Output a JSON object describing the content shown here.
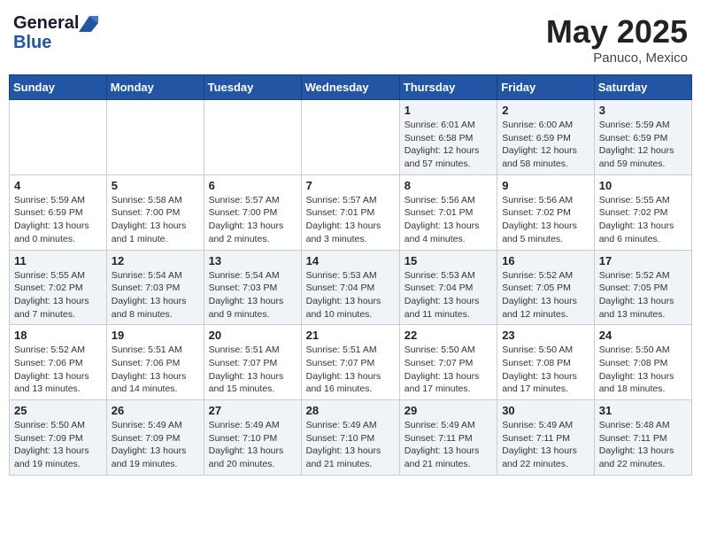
{
  "header": {
    "logo_line1": "General",
    "logo_line2": "Blue",
    "month": "May 2025",
    "location": "Panuco, Mexico"
  },
  "weekdays": [
    "Sunday",
    "Monday",
    "Tuesday",
    "Wednesday",
    "Thursday",
    "Friday",
    "Saturday"
  ],
  "weeks": [
    [
      {
        "day": "",
        "sunrise": "",
        "sunset": "",
        "daylight": ""
      },
      {
        "day": "",
        "sunrise": "",
        "sunset": "",
        "daylight": ""
      },
      {
        "day": "",
        "sunrise": "",
        "sunset": "",
        "daylight": ""
      },
      {
        "day": "",
        "sunrise": "",
        "sunset": "",
        "daylight": ""
      },
      {
        "day": "1",
        "sunrise": "Sunrise: 6:01 AM",
        "sunset": "Sunset: 6:58 PM",
        "daylight": "Daylight: 12 hours and 57 minutes."
      },
      {
        "day": "2",
        "sunrise": "Sunrise: 6:00 AM",
        "sunset": "Sunset: 6:59 PM",
        "daylight": "Daylight: 12 hours and 58 minutes."
      },
      {
        "day": "3",
        "sunrise": "Sunrise: 5:59 AM",
        "sunset": "Sunset: 6:59 PM",
        "daylight": "Daylight: 12 hours and 59 minutes."
      }
    ],
    [
      {
        "day": "4",
        "sunrise": "Sunrise: 5:59 AM",
        "sunset": "Sunset: 6:59 PM",
        "daylight": "Daylight: 13 hours and 0 minutes."
      },
      {
        "day": "5",
        "sunrise": "Sunrise: 5:58 AM",
        "sunset": "Sunset: 7:00 PM",
        "daylight": "Daylight: 13 hours and 1 minute."
      },
      {
        "day": "6",
        "sunrise": "Sunrise: 5:57 AM",
        "sunset": "Sunset: 7:00 PM",
        "daylight": "Daylight: 13 hours and 2 minutes."
      },
      {
        "day": "7",
        "sunrise": "Sunrise: 5:57 AM",
        "sunset": "Sunset: 7:01 PM",
        "daylight": "Daylight: 13 hours and 3 minutes."
      },
      {
        "day": "8",
        "sunrise": "Sunrise: 5:56 AM",
        "sunset": "Sunset: 7:01 PM",
        "daylight": "Daylight: 13 hours and 4 minutes."
      },
      {
        "day": "9",
        "sunrise": "Sunrise: 5:56 AM",
        "sunset": "Sunset: 7:02 PM",
        "daylight": "Daylight: 13 hours and 5 minutes."
      },
      {
        "day": "10",
        "sunrise": "Sunrise: 5:55 AM",
        "sunset": "Sunset: 7:02 PM",
        "daylight": "Daylight: 13 hours and 6 minutes."
      }
    ],
    [
      {
        "day": "11",
        "sunrise": "Sunrise: 5:55 AM",
        "sunset": "Sunset: 7:02 PM",
        "daylight": "Daylight: 13 hours and 7 minutes."
      },
      {
        "day": "12",
        "sunrise": "Sunrise: 5:54 AM",
        "sunset": "Sunset: 7:03 PM",
        "daylight": "Daylight: 13 hours and 8 minutes."
      },
      {
        "day": "13",
        "sunrise": "Sunrise: 5:54 AM",
        "sunset": "Sunset: 7:03 PM",
        "daylight": "Daylight: 13 hours and 9 minutes."
      },
      {
        "day": "14",
        "sunrise": "Sunrise: 5:53 AM",
        "sunset": "Sunset: 7:04 PM",
        "daylight": "Daylight: 13 hours and 10 minutes."
      },
      {
        "day": "15",
        "sunrise": "Sunrise: 5:53 AM",
        "sunset": "Sunset: 7:04 PM",
        "daylight": "Daylight: 13 hours and 11 minutes."
      },
      {
        "day": "16",
        "sunrise": "Sunrise: 5:52 AM",
        "sunset": "Sunset: 7:05 PM",
        "daylight": "Daylight: 13 hours and 12 minutes."
      },
      {
        "day": "17",
        "sunrise": "Sunrise: 5:52 AM",
        "sunset": "Sunset: 7:05 PM",
        "daylight": "Daylight: 13 hours and 13 minutes."
      }
    ],
    [
      {
        "day": "18",
        "sunrise": "Sunrise: 5:52 AM",
        "sunset": "Sunset: 7:06 PM",
        "daylight": "Daylight: 13 hours and 13 minutes."
      },
      {
        "day": "19",
        "sunrise": "Sunrise: 5:51 AM",
        "sunset": "Sunset: 7:06 PM",
        "daylight": "Daylight: 13 hours and 14 minutes."
      },
      {
        "day": "20",
        "sunrise": "Sunrise: 5:51 AM",
        "sunset": "Sunset: 7:07 PM",
        "daylight": "Daylight: 13 hours and 15 minutes."
      },
      {
        "day": "21",
        "sunrise": "Sunrise: 5:51 AM",
        "sunset": "Sunset: 7:07 PM",
        "daylight": "Daylight: 13 hours and 16 minutes."
      },
      {
        "day": "22",
        "sunrise": "Sunrise: 5:50 AM",
        "sunset": "Sunset: 7:07 PM",
        "daylight": "Daylight: 13 hours and 17 minutes."
      },
      {
        "day": "23",
        "sunrise": "Sunrise: 5:50 AM",
        "sunset": "Sunset: 7:08 PM",
        "daylight": "Daylight: 13 hours and 17 minutes."
      },
      {
        "day": "24",
        "sunrise": "Sunrise: 5:50 AM",
        "sunset": "Sunset: 7:08 PM",
        "daylight": "Daylight: 13 hours and 18 minutes."
      }
    ],
    [
      {
        "day": "25",
        "sunrise": "Sunrise: 5:50 AM",
        "sunset": "Sunset: 7:09 PM",
        "daylight": "Daylight: 13 hours and 19 minutes."
      },
      {
        "day": "26",
        "sunrise": "Sunrise: 5:49 AM",
        "sunset": "Sunset: 7:09 PM",
        "daylight": "Daylight: 13 hours and 19 minutes."
      },
      {
        "day": "27",
        "sunrise": "Sunrise: 5:49 AM",
        "sunset": "Sunset: 7:10 PM",
        "daylight": "Daylight: 13 hours and 20 minutes."
      },
      {
        "day": "28",
        "sunrise": "Sunrise: 5:49 AM",
        "sunset": "Sunset: 7:10 PM",
        "daylight": "Daylight: 13 hours and 21 minutes."
      },
      {
        "day": "29",
        "sunrise": "Sunrise: 5:49 AM",
        "sunset": "Sunset: 7:11 PM",
        "daylight": "Daylight: 13 hours and 21 minutes."
      },
      {
        "day": "30",
        "sunrise": "Sunrise: 5:49 AM",
        "sunset": "Sunset: 7:11 PM",
        "daylight": "Daylight: 13 hours and 22 minutes."
      },
      {
        "day": "31",
        "sunrise": "Sunrise: 5:48 AM",
        "sunset": "Sunset: 7:11 PM",
        "daylight": "Daylight: 13 hours and 22 minutes."
      }
    ]
  ]
}
